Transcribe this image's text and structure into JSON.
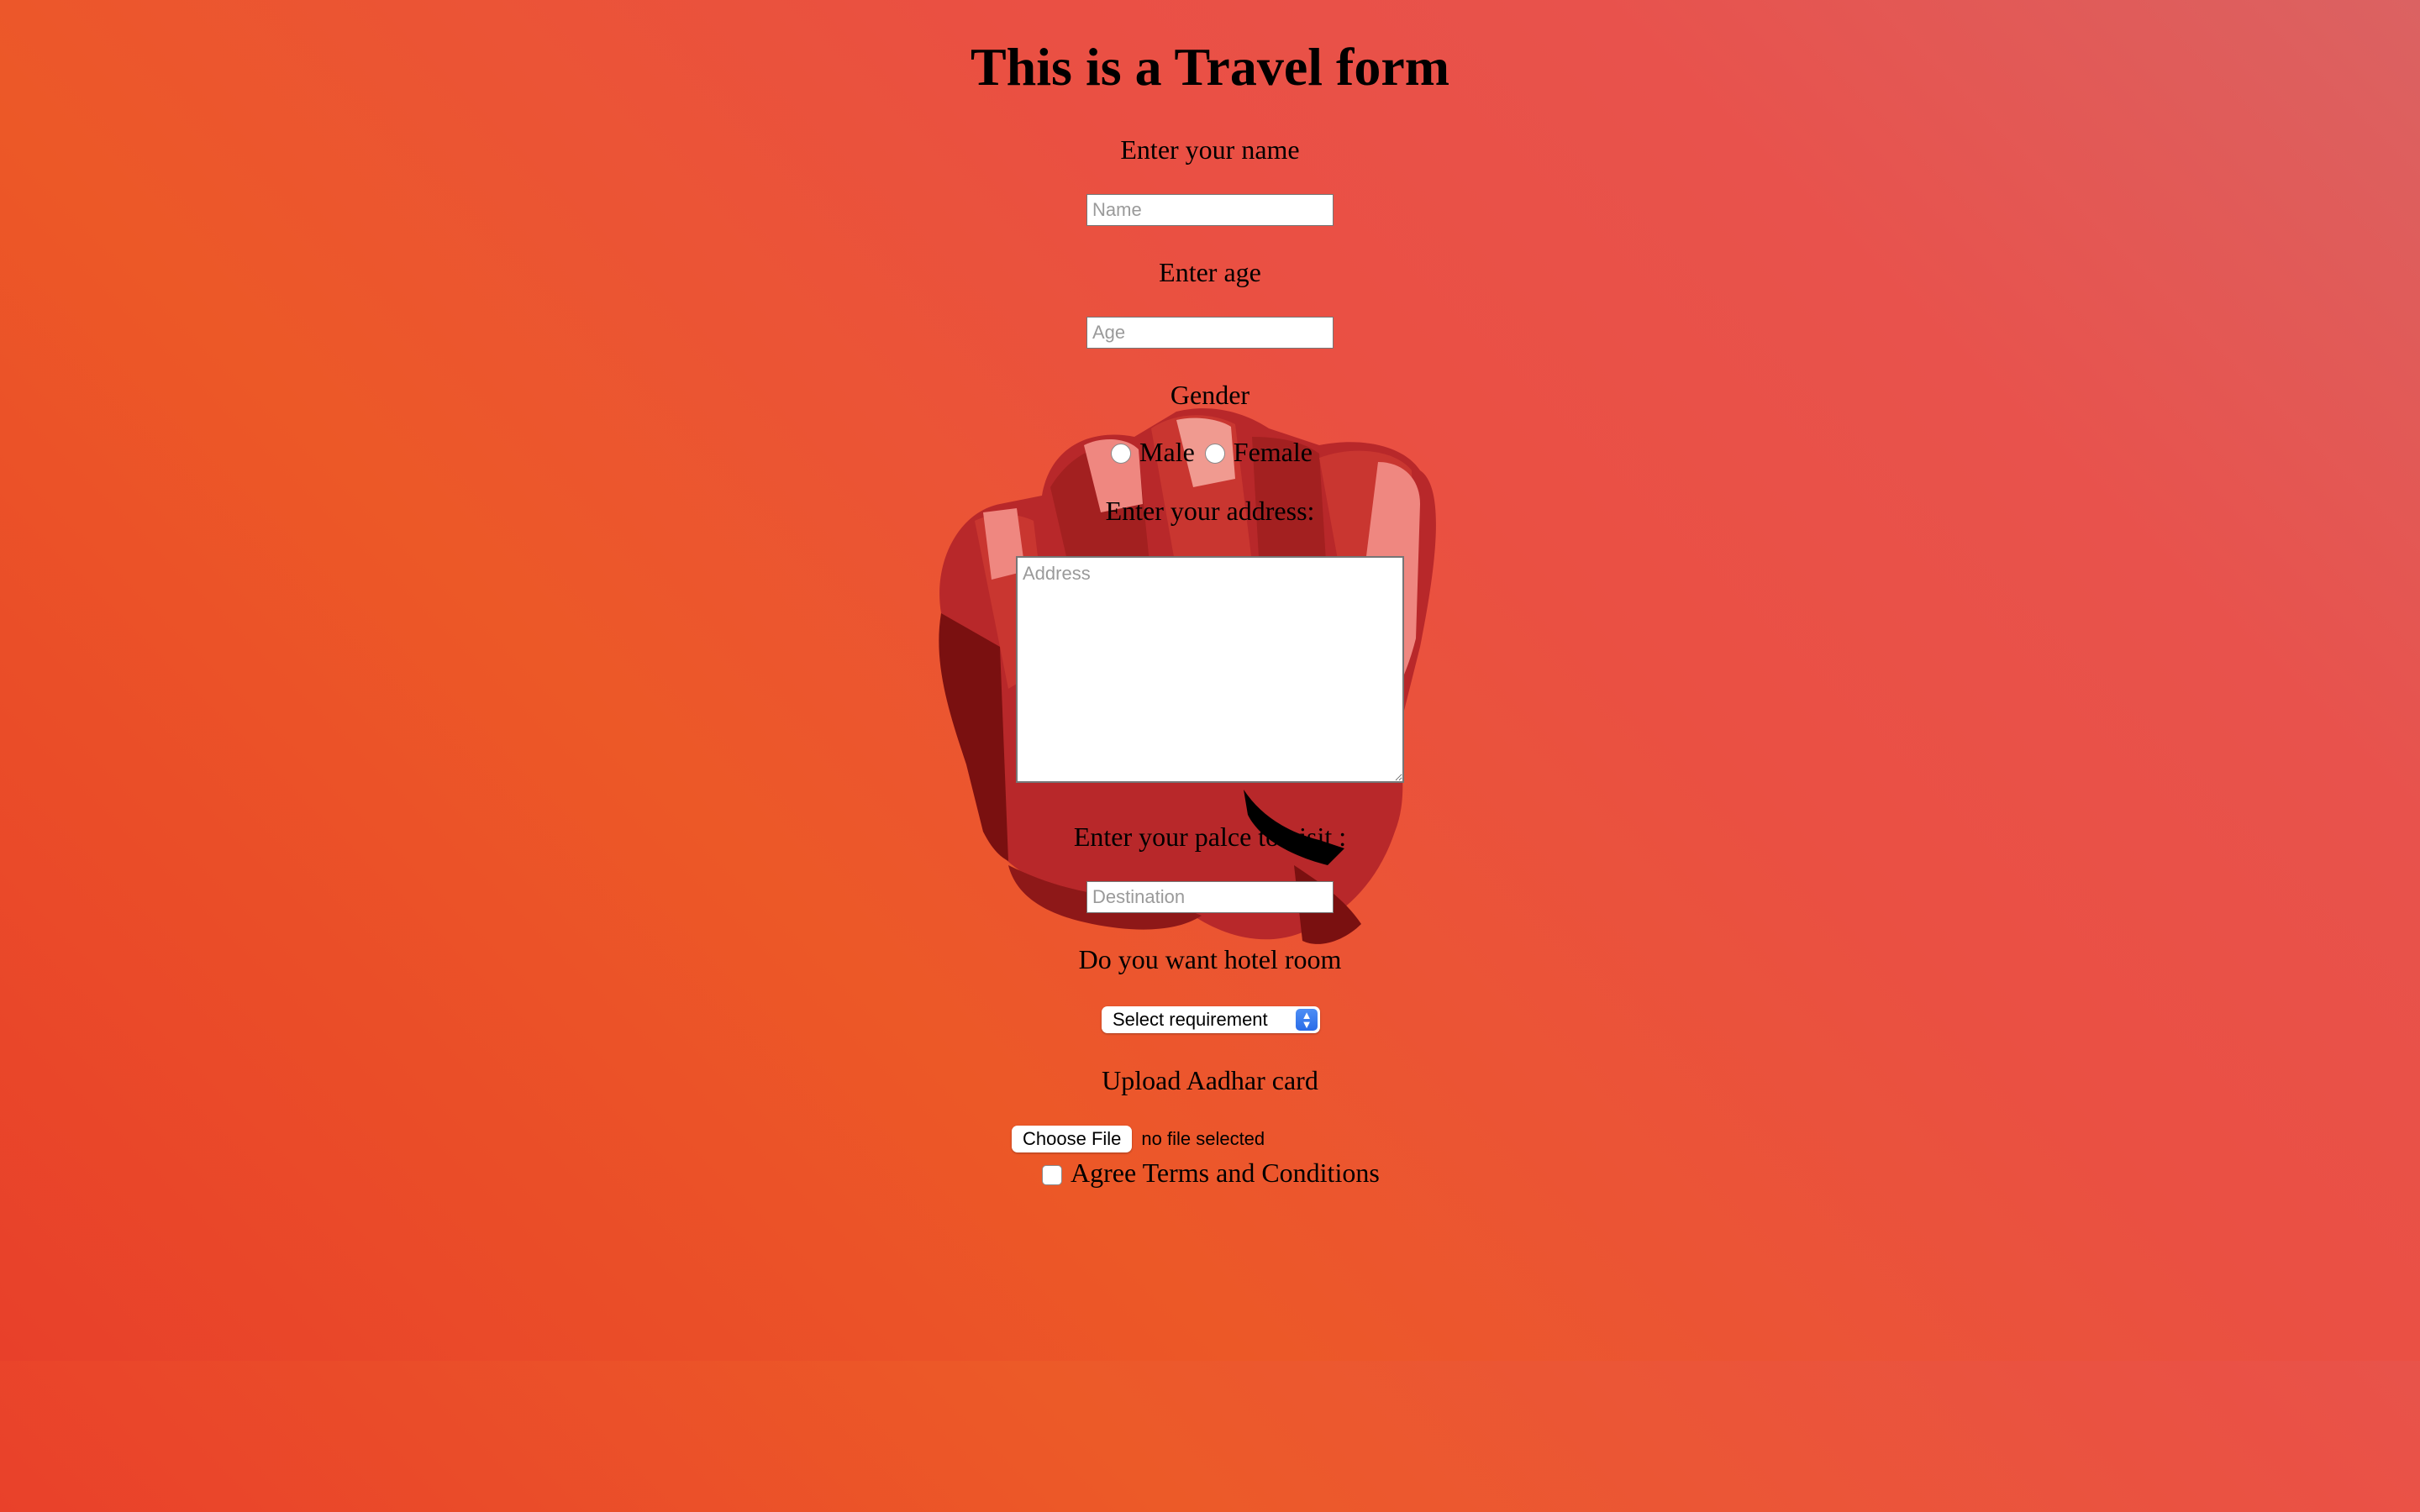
{
  "form": {
    "title": "This is a Travel form",
    "name_label": "Enter your name",
    "name_placeholder": "Name",
    "age_label": "Enter age",
    "age_placeholder": "Age",
    "gender_label": "Gender",
    "gender_options": [
      "Male",
      "Female"
    ],
    "address_label": "Enter your address:",
    "address_placeholder": "Address",
    "destination_label": "Enter your palce to visit :",
    "destination_placeholder": "Destination",
    "hotel_label": "Do you want hotel room",
    "hotel_select_value": "Select requirement",
    "aadhar_label": "Upload Aadhar card",
    "file_button_label": "Choose File",
    "file_status": "no file selected",
    "terms_label": "Agree Terms and Conditions"
  },
  "background": {
    "image": "red-fist-illustration",
    "gradient_colors": [
      "#e8402a",
      "#ec5827",
      "#ea5043",
      "#db6262"
    ]
  }
}
